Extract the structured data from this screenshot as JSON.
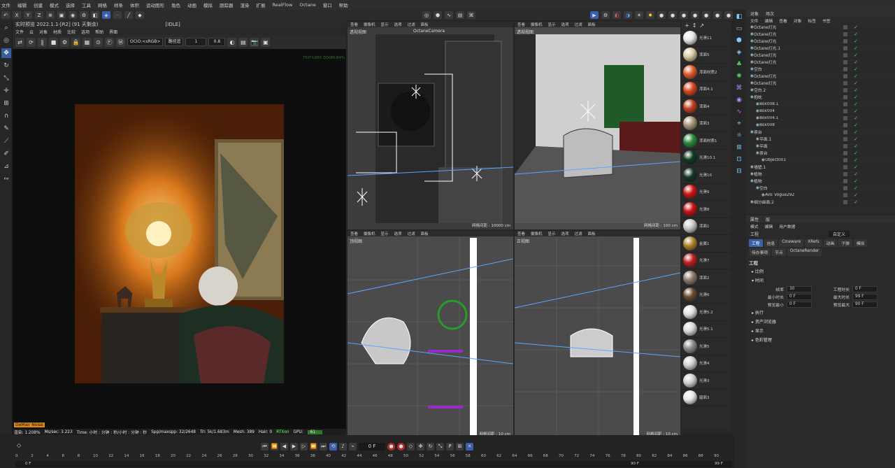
{
  "menubar": [
    "文件",
    "编辑",
    "创建",
    "模式",
    "选择",
    "工具",
    "网格",
    "样条",
    "体积",
    "运动图形",
    "角色",
    "动画",
    "模拟",
    "跟踪器",
    "渲染",
    "扩展",
    "RealFlow",
    "Octane",
    "窗口",
    "帮助"
  ],
  "axes": [
    "X",
    "Y",
    "Z"
  ],
  "render_view": {
    "title": "实时预览 2022.1.1-[R2] (91 天剩余)",
    "status_tag": "[IDLE]",
    "menu": [
      "文件",
      "云",
      "对象",
      "材质",
      "比较",
      "选项",
      "帮助",
      "界面"
    ],
    "ocio": "OCIO:<sRGB>",
    "mode": "路径追",
    "field1": "1",
    "field2": "0.8",
    "res_label": "750*1000 ZOOM:84%",
    "denoise": "DeMair Noise"
  },
  "status": {
    "render": "渲染: 1.208%",
    "ms": "Ms/sec: 3.223",
    "time": "Time: 小时 : 分钟 : 秒/小时 : 分钟 : 秒",
    "spp": "Spp/maxspp: 32/2648",
    "tri": "Tri: 5k/1.683m",
    "mesh": "Mesh: 389",
    "hair": "Hair: 0",
    "rtx": "RTXon",
    "gpu": "GPU:",
    "gpu_val": "61"
  },
  "viewport_menu": [
    "查看",
    "摄像机",
    "显示",
    "选项",
    "过滤",
    "面板"
  ],
  "viewports": [
    {
      "label": "透视视图",
      "cam": "OctaneCamera",
      "grid": "网格间距 : 10000 cm"
    },
    {
      "label": "透视视图",
      "cam": "",
      "grid": "网格间距 : 100 cm"
    },
    {
      "label": "顶视图",
      "cam": "",
      "grid": "网格间距 : 10 cm"
    },
    {
      "label": "正视图",
      "cam": "",
      "grid": "网格间距 : 10 cm"
    }
  ],
  "materials": [
    {
      "name": "光滑11",
      "color": "#e8e8e8"
    },
    {
      "name": "漆面5",
      "color": "#d8c9a0"
    },
    {
      "name": "漆面材质2",
      "color": "#e05a2a"
    },
    {
      "name": "漆面4.1",
      "color": "#d8451e"
    },
    {
      "name": "漆面4",
      "color": "#c04020"
    },
    {
      "name": "漆面3",
      "color": "#a89478"
    },
    {
      "name": "漆面材质1",
      "color": "#2a8a3a"
    },
    {
      "name": "光滑10.1",
      "color": "#0f3a1f"
    },
    {
      "name": "光滑10",
      "color": "#123820"
    },
    {
      "name": "光滑9",
      "color": "#d01414"
    },
    {
      "name": "光滑8",
      "color": "#c81212"
    },
    {
      "name": "漆面1",
      "color": "#c8c8c8"
    },
    {
      "name": "金属1",
      "color": "#b0842a"
    },
    {
      "name": "光滑7",
      "color": "#c02020"
    },
    {
      "name": "漆面2",
      "color": "#8a7a6a"
    },
    {
      "name": "光滑6",
      "color": "#6a4a30"
    },
    {
      "name": "光滑5.2",
      "color": "#e0e0e0"
    },
    {
      "name": "光滑5.1",
      "color": "#d8d8d8"
    },
    {
      "name": "光滑5",
      "color": "#8a8a8a"
    },
    {
      "name": "光滑4",
      "color": "#d0d0d0"
    },
    {
      "name": "光滑3",
      "color": "#cfcfcf"
    },
    {
      "name": "磨面3",
      "color": "#e8e8e8"
    }
  ],
  "object_panel": {
    "tabs": [
      "对象",
      "场次"
    ],
    "menu": [
      "文件",
      "编辑",
      "查看",
      "对象",
      "标签",
      "书签"
    ],
    "rows": [
      {
        "name": "Octane灯光",
        "indent": 0
      },
      {
        "name": "Octane灯光",
        "indent": 0
      },
      {
        "name": "Octane灯光",
        "indent": 0
      },
      {
        "name": "Octane灯光.1",
        "indent": 0
      },
      {
        "name": "Octane灯光",
        "indent": 0
      },
      {
        "name": "Octane灯光",
        "indent": 0
      },
      {
        "name": "空白",
        "indent": 0
      },
      {
        "name": "Octane灯光",
        "indent": 0
      },
      {
        "name": "Octane灯光",
        "indent": 0
      },
      {
        "name": "空白.2",
        "indent": 0
      },
      {
        "name": "抱枕",
        "indent": 0
      },
      {
        "name": "Box008.1",
        "indent": 1
      },
      {
        "name": "Box004",
        "indent": 1
      },
      {
        "name": "Box004.1",
        "indent": 1
      },
      {
        "name": "Box008",
        "indent": 1
      },
      {
        "name": "茶台",
        "indent": 0
      },
      {
        "name": "平面.1",
        "indent": 1
      },
      {
        "name": "平面",
        "indent": 1
      },
      {
        "name": "茶台",
        "indent": 1
      },
      {
        "name": "Object001",
        "indent": 2
      },
      {
        "name": "墙壁.1",
        "indent": 0
      },
      {
        "name": "植物",
        "indent": 0
      },
      {
        "name": "植物",
        "indent": 0
      },
      {
        "name": "空白",
        "indent": 1
      },
      {
        "name": "AVE Vogue292",
        "indent": 2
      },
      {
        "name": "细分曲面.2",
        "indent": 0
      }
    ]
  },
  "attr_panel": {
    "tabs": [
      "属性",
      "层"
    ],
    "menu": [
      "模式",
      "编辑",
      "用户数据"
    ],
    "title": "工程",
    "preset": "自定义",
    "subtabs": [
      "工程",
      "信息",
      "Cineware",
      "XRefs",
      "动画",
      "子弹",
      "模拟",
      "待办事项",
      "节点",
      "OctaneRender"
    ],
    "section": "工程",
    "groups": [
      "比例",
      "时间",
      "执行",
      "资产浏览器",
      "显示",
      "色彩管理"
    ],
    "fields": [
      {
        "l": "帧率",
        "v": "30",
        "l2": "工程时长",
        "v2": "0 F"
      },
      {
        "l": "最小时长",
        "v": "0 F",
        "l2": "最大时长",
        "v2": "99 F"
      },
      {
        "l": "预览最小",
        "v": "0 F",
        "l2": "预览最大",
        "v2": "90 F"
      }
    ]
  },
  "timeline": {
    "current": "0 F",
    "start": "0 F",
    "end_preview": "90 F",
    "end": "99 F",
    "ticks": [
      "0",
      "2",
      "4",
      "6",
      "8",
      "10",
      "12",
      "14",
      "16",
      "18",
      "20",
      "22",
      "24",
      "26",
      "28",
      "30",
      "32",
      "34",
      "36",
      "38",
      "40",
      "42",
      "44",
      "46",
      "48",
      "50",
      "52",
      "54",
      "56",
      "58",
      "60",
      "62",
      "64",
      "66",
      "68",
      "70",
      "72",
      "74",
      "76",
      "78",
      "80",
      "82",
      "84",
      "86",
      "88",
      "90"
    ]
  }
}
